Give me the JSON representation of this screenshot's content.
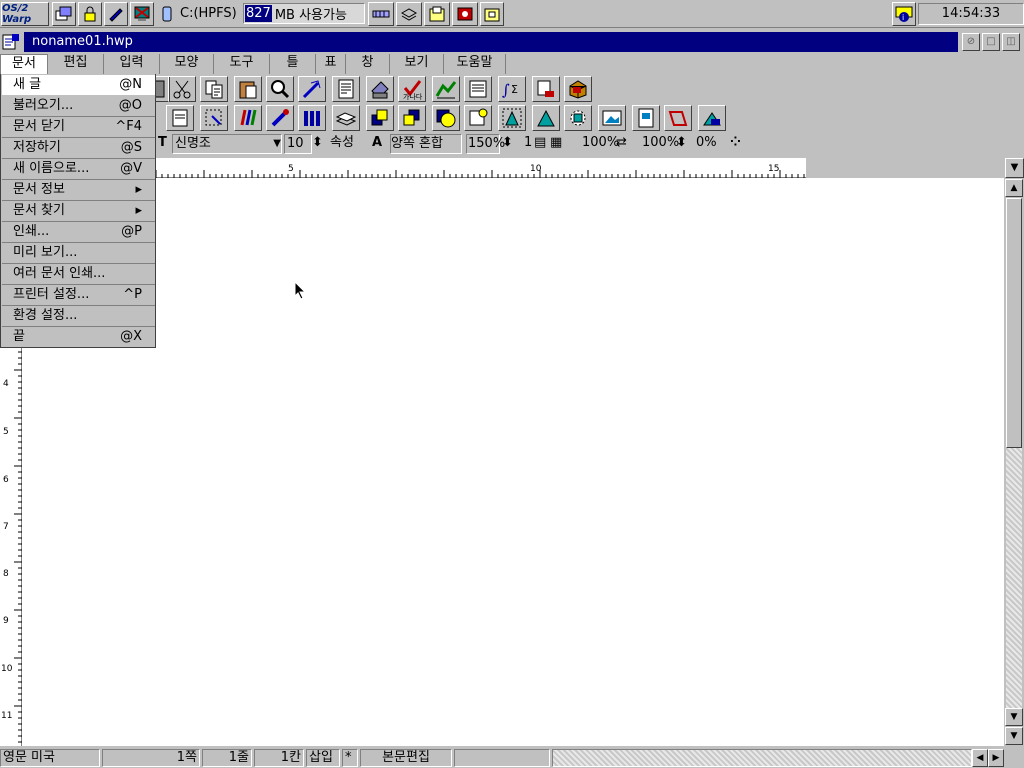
{
  "taskbar": {
    "logo": "OS/2 Warp",
    "icons": [
      "windows-list-icon",
      "lock-icon",
      "pen-icon",
      "monitor-icon",
      "drive-icon"
    ],
    "drive_label": "C:(HPFS)",
    "free_value": "827",
    "free_label": "MB 사용가능",
    "right_icons": [
      "tray-icon",
      "stack-icon",
      "folder-icon",
      "red-tool-icon",
      "folder2-icon"
    ],
    "clock": "14:54:33"
  },
  "window": {
    "title": "noname01.hwp"
  },
  "menubar": {
    "items": [
      "문서",
      "편집",
      "입력",
      "모양",
      "도구",
      "틀",
      "표",
      "창",
      "보기",
      "도움말"
    ],
    "active_index": 0
  },
  "format_bar": {
    "font": "신명조",
    "size": "10",
    "attr_label": "속성",
    "align": "양쪽 혼합",
    "line_spacing": "150%",
    "columns": "1",
    "width_ratio": "100%",
    "letter_width": "100%",
    "letter_spacing": "0%"
  },
  "ruler": {
    "labels": [
      "5",
      "10",
      "15"
    ]
  },
  "vruler": {
    "labels": [
      "4",
      "5",
      "6",
      "7",
      "8",
      "9",
      "10",
      "11"
    ]
  },
  "file_menu": {
    "items": [
      {
        "label": "새 글",
        "shortcut": "@N"
      },
      {
        "label": "불러오기...",
        "shortcut": "@O"
      },
      {
        "label": "문서 닫기",
        "shortcut": "^F4"
      },
      {
        "label": "저장하기",
        "shortcut": "@S"
      },
      {
        "label": "새 이름으로...",
        "shortcut": "@V"
      },
      {
        "label": "문서 정보",
        "shortcut": "▸"
      },
      {
        "label": "문서 찾기",
        "shortcut": "▸"
      },
      {
        "label": "인쇄...",
        "shortcut": "@P"
      },
      {
        "label": "미리 보기...",
        "shortcut": ""
      },
      {
        "label": "여러 문서 인쇄...",
        "shortcut": ""
      },
      {
        "label": "프린터 설정...",
        "shortcut": "^P"
      },
      {
        "label": "환경 설정...",
        "shortcut": ""
      },
      {
        "label": "끝",
        "shortcut": "@X"
      }
    ]
  },
  "statusbar": {
    "mode": "영문 미국",
    "page": "1쪽",
    "line": "1줄",
    "col": "1칸",
    "insert": "삽입",
    "modified": "*",
    "edit_mode": "본문편집"
  }
}
